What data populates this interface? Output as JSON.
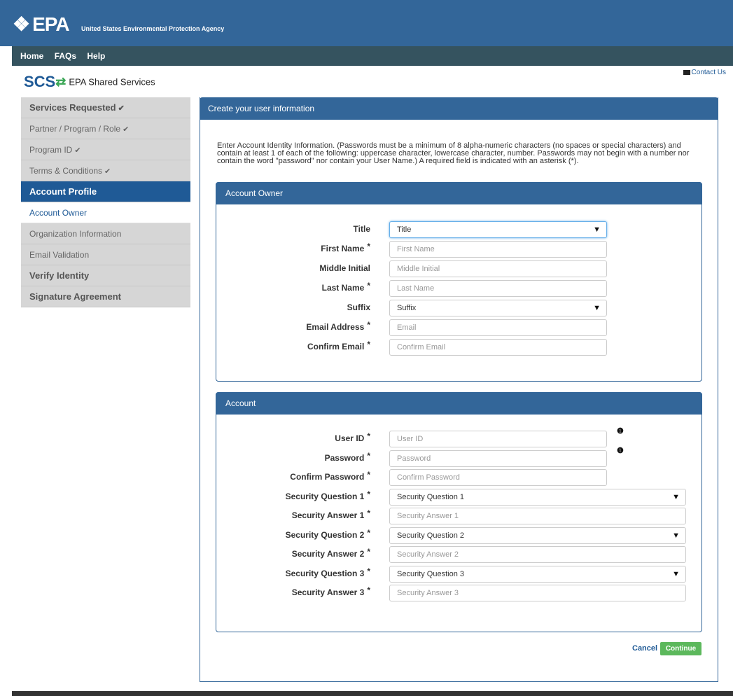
{
  "header": {
    "logo": "EPA",
    "agency": "United States Environmental Protection Agency"
  },
  "nav": [
    {
      "label": "Home"
    },
    {
      "label": "FAQs"
    },
    {
      "label": "Help"
    }
  ],
  "brand": {
    "short": "SCS",
    "name": "EPA Shared Services"
  },
  "contact_label": "Contact Us",
  "sidebar": [
    {
      "label": "Services Requested",
      "check": "✔",
      "style": "bold"
    },
    {
      "label": "Partner / Program / Role",
      "check": "✔",
      "style": "normal"
    },
    {
      "label": "Program ID",
      "check": "✔",
      "style": "normal"
    },
    {
      "label": "Terms & Conditions",
      "check": "✔",
      "style": "normal"
    },
    {
      "label": "Account Profile",
      "check": "",
      "style": "active"
    },
    {
      "label": "Account Owner",
      "check": "",
      "style": "white"
    },
    {
      "label": "Organization Information",
      "check": "",
      "style": "normal"
    },
    {
      "label": "Email Validation",
      "check": "",
      "style": "normal"
    },
    {
      "label": "Verify Identity",
      "check": "",
      "style": "bold"
    },
    {
      "label": "Signature Agreement",
      "check": "",
      "style": "bold"
    }
  ],
  "main": {
    "title": "Create your user information",
    "intro": "Enter Account Identity Information. (Passwords must be a minimum of 8 alpha-numeric characters (no spaces or special characters) and contain at least 1 of each of the following: uppercase character, lowercase character, number. Passwords may not begin with a number nor contain the word \"password\" nor contain your User Name.) A required field is indicated with an asterisk (*)."
  },
  "owner": {
    "title": "Account Owner",
    "fields": [
      {
        "label": "Title",
        "required": "",
        "type": "select",
        "value": "Title"
      },
      {
        "label": "First Name",
        "required": "*",
        "type": "input",
        "placeholder": "First Name"
      },
      {
        "label": "Middle Initial",
        "required": "",
        "type": "input",
        "placeholder": "Middle Initial"
      },
      {
        "label": "Last Name",
        "required": "*",
        "type": "input",
        "placeholder": "Last Name"
      },
      {
        "label": "Suffix",
        "required": "",
        "type": "select",
        "value": "Suffix"
      },
      {
        "label": "Email Address",
        "required": "*",
        "type": "input",
        "placeholder": "Email"
      },
      {
        "label": "Confirm Email",
        "required": "*",
        "type": "input",
        "placeholder": "Confirm Email"
      }
    ]
  },
  "account": {
    "title": "Account",
    "fields": [
      {
        "label": "User ID",
        "required": "*",
        "type": "input",
        "placeholder": "User ID",
        "info": true
      },
      {
        "label": "Password",
        "required": "*",
        "type": "input",
        "placeholder": "Password",
        "info": true
      },
      {
        "label": "Confirm Password",
        "required": "*",
        "type": "input",
        "placeholder": "Confirm Password"
      },
      {
        "label": "Security Question 1",
        "required": "*",
        "type": "select",
        "value": "Security Question 1"
      },
      {
        "label": "Security Answer 1",
        "required": "*",
        "type": "input",
        "placeholder": "Security Answer 1"
      },
      {
        "label": "Security Question 2",
        "required": "*",
        "type": "select",
        "value": "Security Question 2"
      },
      {
        "label": "Security Answer 2",
        "required": "*",
        "type": "input",
        "placeholder": "Security Answer 2"
      },
      {
        "label": "Security Question 3",
        "required": "*",
        "type": "select",
        "value": "Security Question 3"
      },
      {
        "label": "Security Answer 3",
        "required": "*",
        "type": "input",
        "placeholder": "Security Answer 3"
      }
    ]
  },
  "actions": {
    "cancel": "Cancel",
    "continue": "Continue"
  },
  "icons": {
    "info": "info-icon",
    "caret": "caret-down-icon",
    "envelope": "envelope-icon",
    "check": "check-icon"
  },
  "colors": {
    "primary": "#336699",
    "nav": "#35535f",
    "success": "#5cb85c",
    "sidebar": "#d6d6d6",
    "active": "#1f5a96"
  }
}
